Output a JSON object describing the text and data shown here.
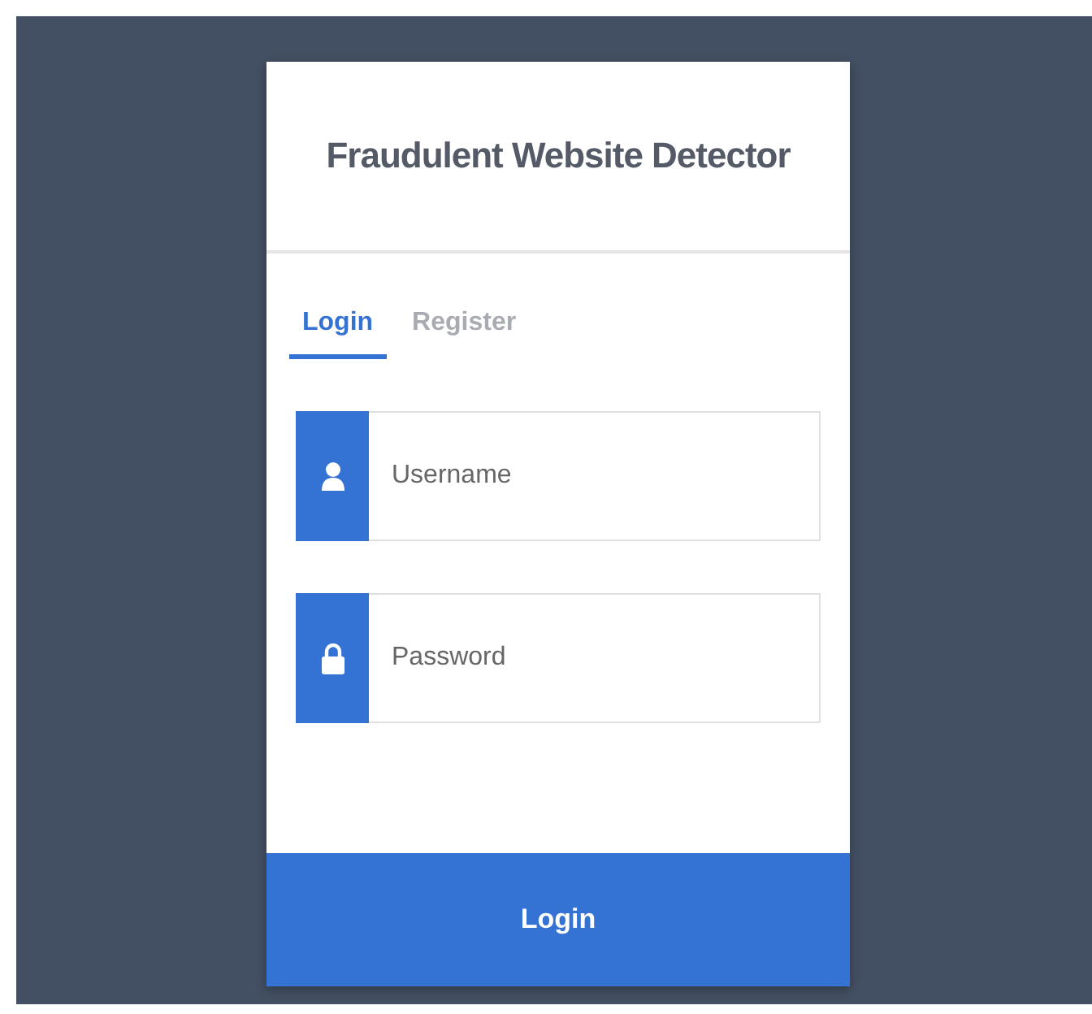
{
  "title": "Fraudulent Website Detector",
  "tabs": [
    {
      "label": "Login",
      "selected": true
    },
    {
      "label": "Register",
      "selected": false
    }
  ],
  "fields": [
    {
      "kind": "user",
      "placeholder": "Username"
    },
    {
      "kind": "lock",
      "placeholder": "Password"
    }
  ],
  "button": "Login"
}
